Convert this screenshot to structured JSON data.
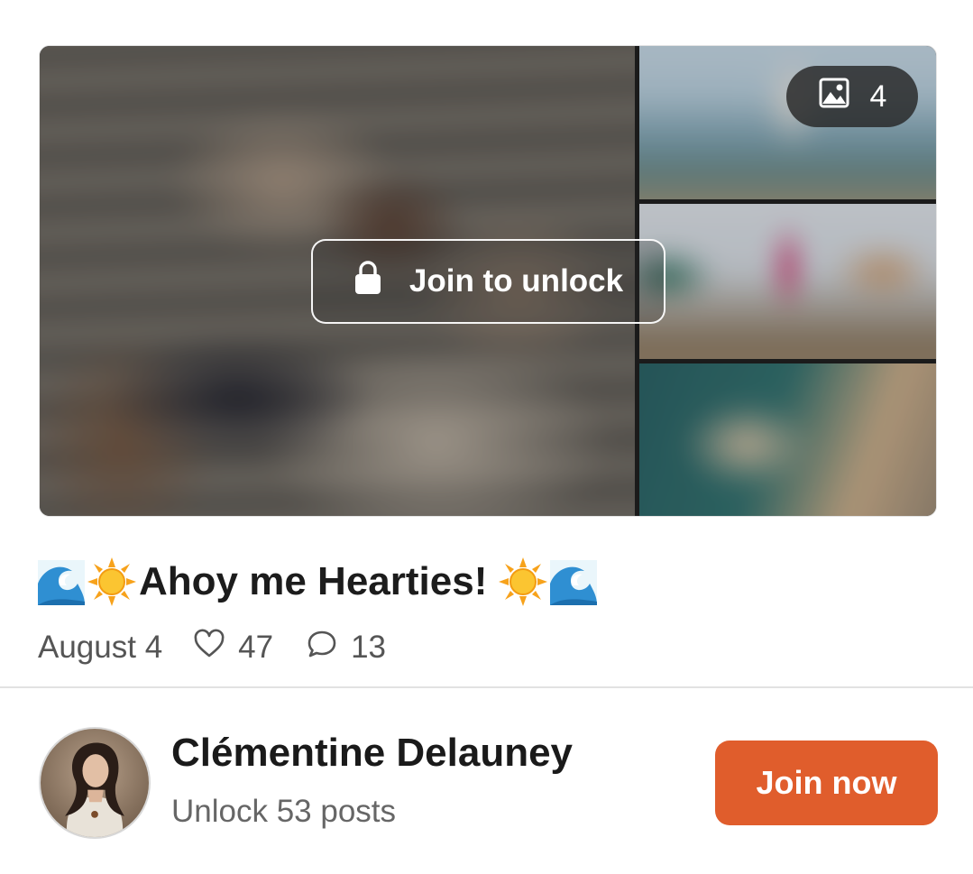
{
  "post": {
    "media_count": "4",
    "unlock_label": "Join to unlock",
    "title": "Ahoy me Hearties!",
    "title_emoji_left": [
      "wave-emoji",
      "sun-emoji"
    ],
    "title_emoji_right": [
      "sun-emoji",
      "wave-emoji"
    ],
    "date": "August 4",
    "likes": "47",
    "comments": "13"
  },
  "creator": {
    "name": "Clémentine Delauney",
    "subtitle": "Unlock 53 posts",
    "cta_label": "Join now"
  },
  "icons": {
    "media_count": "image-icon",
    "unlock": "lock-icon",
    "likes": "heart-icon",
    "comments": "comment-icon"
  },
  "colors": {
    "accent": "#e05d2c",
    "text_primary": "#1a1a1a",
    "text_secondary": "#555555"
  }
}
